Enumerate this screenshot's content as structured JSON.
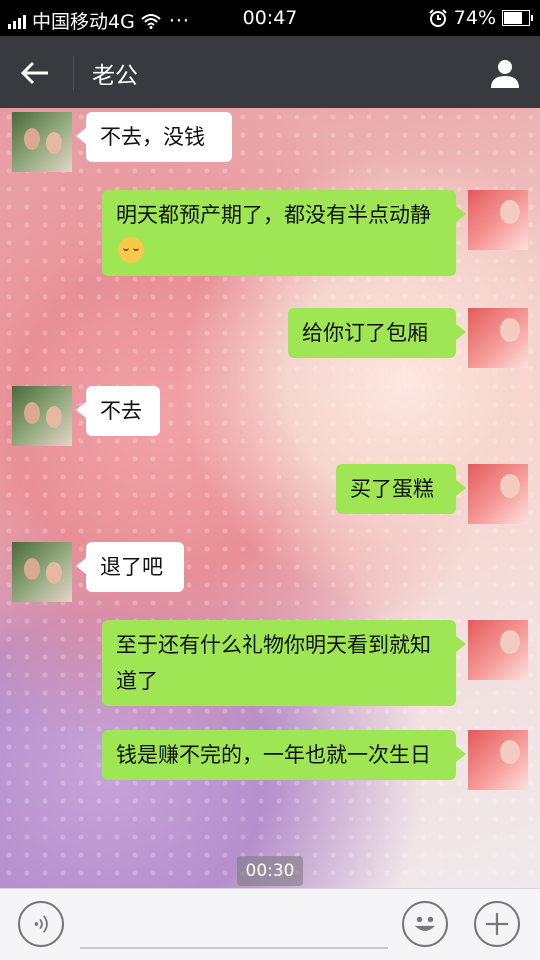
{
  "status_bar": {
    "carrier": "中国移动4G",
    "more": "···",
    "time": "00:47",
    "battery": "74%",
    "battery_level": 0.74,
    "icons": [
      "signal-icon",
      "wifi-icon",
      "alarm-icon",
      "battery-icon"
    ]
  },
  "header": {
    "title": "老公",
    "back_icon": "arrow-left-icon",
    "profile_icon": "user-icon"
  },
  "messages": [
    {
      "side": "in",
      "text": "不去，没钱"
    },
    {
      "side": "out",
      "text": "明天都预产期了，都没有半点动静",
      "emoji": "relieved-face"
    },
    {
      "side": "out",
      "text": "给你订了包厢"
    },
    {
      "side": "in",
      "text": "不去"
    },
    {
      "side": "out",
      "text": "买了蛋糕"
    },
    {
      "side": "in",
      "text": "退了吧"
    },
    {
      "side": "out",
      "text": "至于还有什么礼物你明天看到就知道了"
    },
    {
      "side": "out",
      "text": "钱是赚不完的，一年也就一次生日"
    }
  ],
  "timestamp": "00:30",
  "input_bar": {
    "voice_icon": "voice-icon",
    "emoji_icon": "emoji-icon",
    "plus_icon": "plus-icon"
  },
  "colors": {
    "header_bg": "#393a3f",
    "outgoing_bubble": "#9ee653",
    "incoming_bubble": "#ffffff",
    "status_bar_bg": "#000000"
  }
}
